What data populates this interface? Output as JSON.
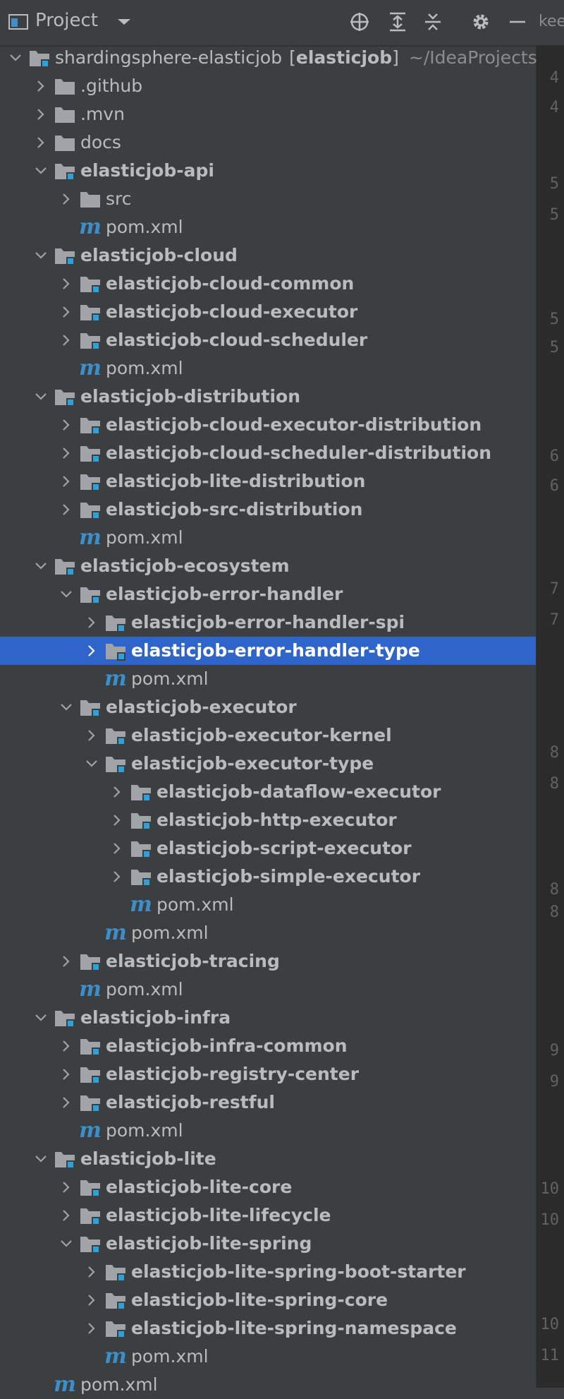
{
  "toolbar": {
    "title": "Project",
    "icons": [
      "project-view-icon",
      "dropdown-chevron-icon",
      "locate-icon",
      "expand-all-icon",
      "collapse-all-icon",
      "gear-icon",
      "minimize-icon"
    ]
  },
  "editor": {
    "tab_label": "kee",
    "gutter_numbers": [
      "4",
      "4",
      "5",
      "5",
      "5",
      "5",
      "6",
      "6",
      "7",
      "7",
      "8",
      "8",
      "8",
      "8",
      "9",
      "9",
      "10",
      "10",
      "10",
      "11"
    ]
  },
  "tree": [
    {
      "label": "shardingsphere-elasticjob",
      "suffix": "[elasticjob]",
      "hint": "~/IdeaProjects",
      "type": "module",
      "depth": 0,
      "expanded": true,
      "bold": false
    },
    {
      "label": ".github",
      "type": "folder",
      "depth": 1,
      "expanded": false,
      "bold": false
    },
    {
      "label": ".mvn",
      "type": "folder",
      "depth": 1,
      "expanded": false,
      "bold": false
    },
    {
      "label": "docs",
      "type": "folder",
      "depth": 1,
      "expanded": false,
      "bold": false
    },
    {
      "label": "elasticjob-api",
      "type": "module",
      "depth": 1,
      "expanded": true,
      "bold": true
    },
    {
      "label": "src",
      "type": "folder",
      "depth": 2,
      "expanded": false,
      "bold": false
    },
    {
      "label": "pom.xml",
      "type": "pom",
      "depth": 2,
      "bold": false
    },
    {
      "label": "elasticjob-cloud",
      "type": "module",
      "depth": 1,
      "expanded": true,
      "bold": true
    },
    {
      "label": "elasticjob-cloud-common",
      "type": "module",
      "depth": 2,
      "expanded": false,
      "bold": true
    },
    {
      "label": "elasticjob-cloud-executor",
      "type": "module",
      "depth": 2,
      "expanded": false,
      "bold": true
    },
    {
      "label": "elasticjob-cloud-scheduler",
      "type": "module",
      "depth": 2,
      "expanded": false,
      "bold": true
    },
    {
      "label": "pom.xml",
      "type": "pom",
      "depth": 2,
      "bold": false
    },
    {
      "label": "elasticjob-distribution",
      "type": "module",
      "depth": 1,
      "expanded": true,
      "bold": true
    },
    {
      "label": "elasticjob-cloud-executor-distribution",
      "type": "module",
      "depth": 2,
      "expanded": false,
      "bold": true
    },
    {
      "label": "elasticjob-cloud-scheduler-distribution",
      "type": "module",
      "depth": 2,
      "expanded": false,
      "bold": true
    },
    {
      "label": "elasticjob-lite-distribution",
      "type": "module",
      "depth": 2,
      "expanded": false,
      "bold": true
    },
    {
      "label": "elasticjob-src-distribution",
      "type": "module",
      "depth": 2,
      "expanded": false,
      "bold": true
    },
    {
      "label": "pom.xml",
      "type": "pom",
      "depth": 2,
      "bold": false
    },
    {
      "label": "elasticjob-ecosystem",
      "type": "module",
      "depth": 1,
      "expanded": true,
      "bold": true
    },
    {
      "label": "elasticjob-error-handler",
      "type": "module",
      "depth": 2,
      "expanded": true,
      "bold": true
    },
    {
      "label": "elasticjob-error-handler-spi",
      "type": "module",
      "depth": 3,
      "expanded": false,
      "bold": true
    },
    {
      "label": "elasticjob-error-handler-type",
      "type": "module",
      "depth": 3,
      "expanded": false,
      "bold": true,
      "selected": true
    },
    {
      "label": "pom.xml",
      "type": "pom",
      "depth": 3,
      "bold": false
    },
    {
      "label": "elasticjob-executor",
      "type": "module",
      "depth": 2,
      "expanded": true,
      "bold": true
    },
    {
      "label": "elasticjob-executor-kernel",
      "type": "module",
      "depth": 3,
      "expanded": false,
      "bold": true
    },
    {
      "label": "elasticjob-executor-type",
      "type": "module",
      "depth": 3,
      "expanded": true,
      "bold": true
    },
    {
      "label": "elasticjob-dataflow-executor",
      "type": "module",
      "depth": 4,
      "expanded": false,
      "bold": true
    },
    {
      "label": "elasticjob-http-executor",
      "type": "module",
      "depth": 4,
      "expanded": false,
      "bold": true
    },
    {
      "label": "elasticjob-script-executor",
      "type": "module",
      "depth": 4,
      "expanded": false,
      "bold": true
    },
    {
      "label": "elasticjob-simple-executor",
      "type": "module",
      "depth": 4,
      "expanded": false,
      "bold": true
    },
    {
      "label": "pom.xml",
      "type": "pom",
      "depth": 4,
      "bold": false
    },
    {
      "label": "pom.xml",
      "type": "pom",
      "depth": 3,
      "bold": false
    },
    {
      "label": "elasticjob-tracing",
      "type": "module",
      "depth": 2,
      "expanded": false,
      "bold": true
    },
    {
      "label": "pom.xml",
      "type": "pom",
      "depth": 2,
      "bold": false
    },
    {
      "label": "elasticjob-infra",
      "type": "module",
      "depth": 1,
      "expanded": true,
      "bold": true
    },
    {
      "label": "elasticjob-infra-common",
      "type": "module",
      "depth": 2,
      "expanded": false,
      "bold": true
    },
    {
      "label": "elasticjob-registry-center",
      "type": "module",
      "depth": 2,
      "expanded": false,
      "bold": true
    },
    {
      "label": "elasticjob-restful",
      "type": "module",
      "depth": 2,
      "expanded": false,
      "bold": true
    },
    {
      "label": "pom.xml",
      "type": "pom",
      "depth": 2,
      "bold": false
    },
    {
      "label": "elasticjob-lite",
      "type": "module",
      "depth": 1,
      "expanded": true,
      "bold": true
    },
    {
      "label": "elasticjob-lite-core",
      "type": "module",
      "depth": 2,
      "expanded": false,
      "bold": true
    },
    {
      "label": "elasticjob-lite-lifecycle",
      "type": "module",
      "depth": 2,
      "expanded": false,
      "bold": true
    },
    {
      "label": "elasticjob-lite-spring",
      "type": "module",
      "depth": 2,
      "expanded": true,
      "bold": true
    },
    {
      "label": "elasticjob-lite-spring-boot-starter",
      "type": "module",
      "depth": 3,
      "expanded": false,
      "bold": true
    },
    {
      "label": "elasticjob-lite-spring-core",
      "type": "module",
      "depth": 3,
      "expanded": false,
      "bold": true
    },
    {
      "label": "elasticjob-lite-spring-namespace",
      "type": "module",
      "depth": 3,
      "expanded": false,
      "bold": true
    },
    {
      "label": "pom.xml",
      "type": "pom",
      "depth": 3,
      "bold": false
    },
    {
      "label": "pom.xml",
      "type": "pom",
      "depth": 1,
      "bold": false
    }
  ],
  "colors": {
    "panel_bg": "#3c3f41",
    "selection": "#2f65ca",
    "text": "#bbbbbb",
    "folder_icon": "#a0a4a8",
    "module_badge": "#2ea1d8",
    "maven_m": "#3d8ec9"
  }
}
